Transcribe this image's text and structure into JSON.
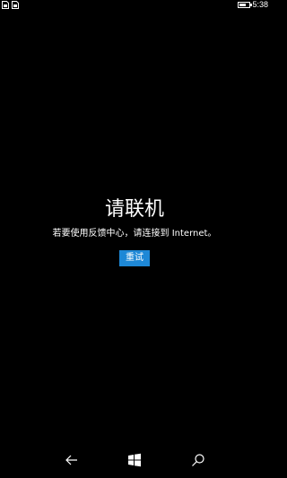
{
  "status_bar": {
    "left_icons": [
      "sim-card-icon",
      "sim-card-icon"
    ],
    "battery_level": 0.65,
    "time": "5:38"
  },
  "main": {
    "title": "请联机",
    "message": "若要使用反馈中心，请连接到 Internet。",
    "retry_label": "重试"
  },
  "nav_bar": {
    "icons": [
      "back-arrow-icon",
      "windows-start-icon",
      "search-icon"
    ]
  },
  "colors": {
    "background": "#000000",
    "accent": "#1e88d6",
    "text": "#ffffff"
  }
}
